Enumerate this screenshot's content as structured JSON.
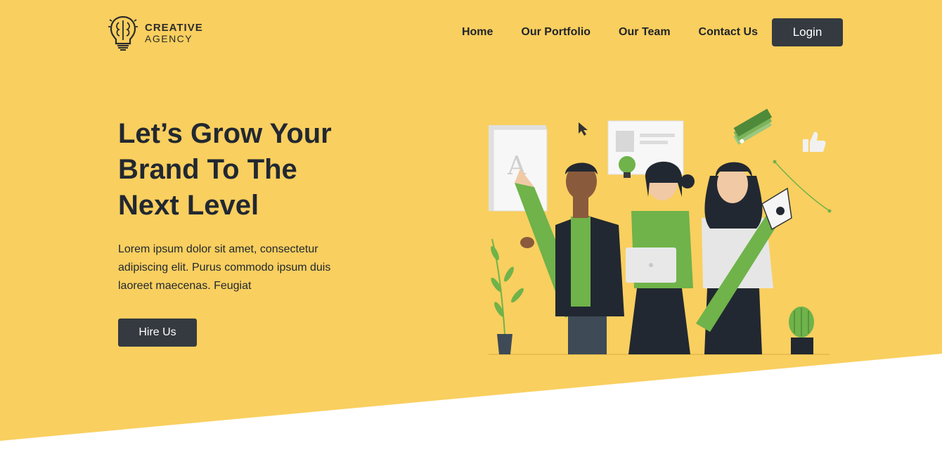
{
  "theme": {
    "accent": "#F9CF5F",
    "dark": "#343A40",
    "green": "#6FB34A"
  },
  "brand": {
    "line1": "CREATIVE",
    "line2": "AGENCY",
    "icon": "lightbulb-brain-icon"
  },
  "nav": {
    "items": [
      "Home",
      "Our Portfolio",
      "Our Team",
      "Contact Us"
    ],
    "login_label": "Login"
  },
  "hero": {
    "title_lines": [
      "Let’s Grow Your",
      "Brand To The",
      "Next Level"
    ],
    "description_lines": [
      "Lorem ipsum dolor sit amet, consectetur",
      "adipiscing elit. Purus commodo ipsum duis",
      "laoreet maecenas. Feugiat"
    ],
    "cta_label": "Hire Us"
  },
  "illustration": {
    "text_card_letter": "A"
  }
}
